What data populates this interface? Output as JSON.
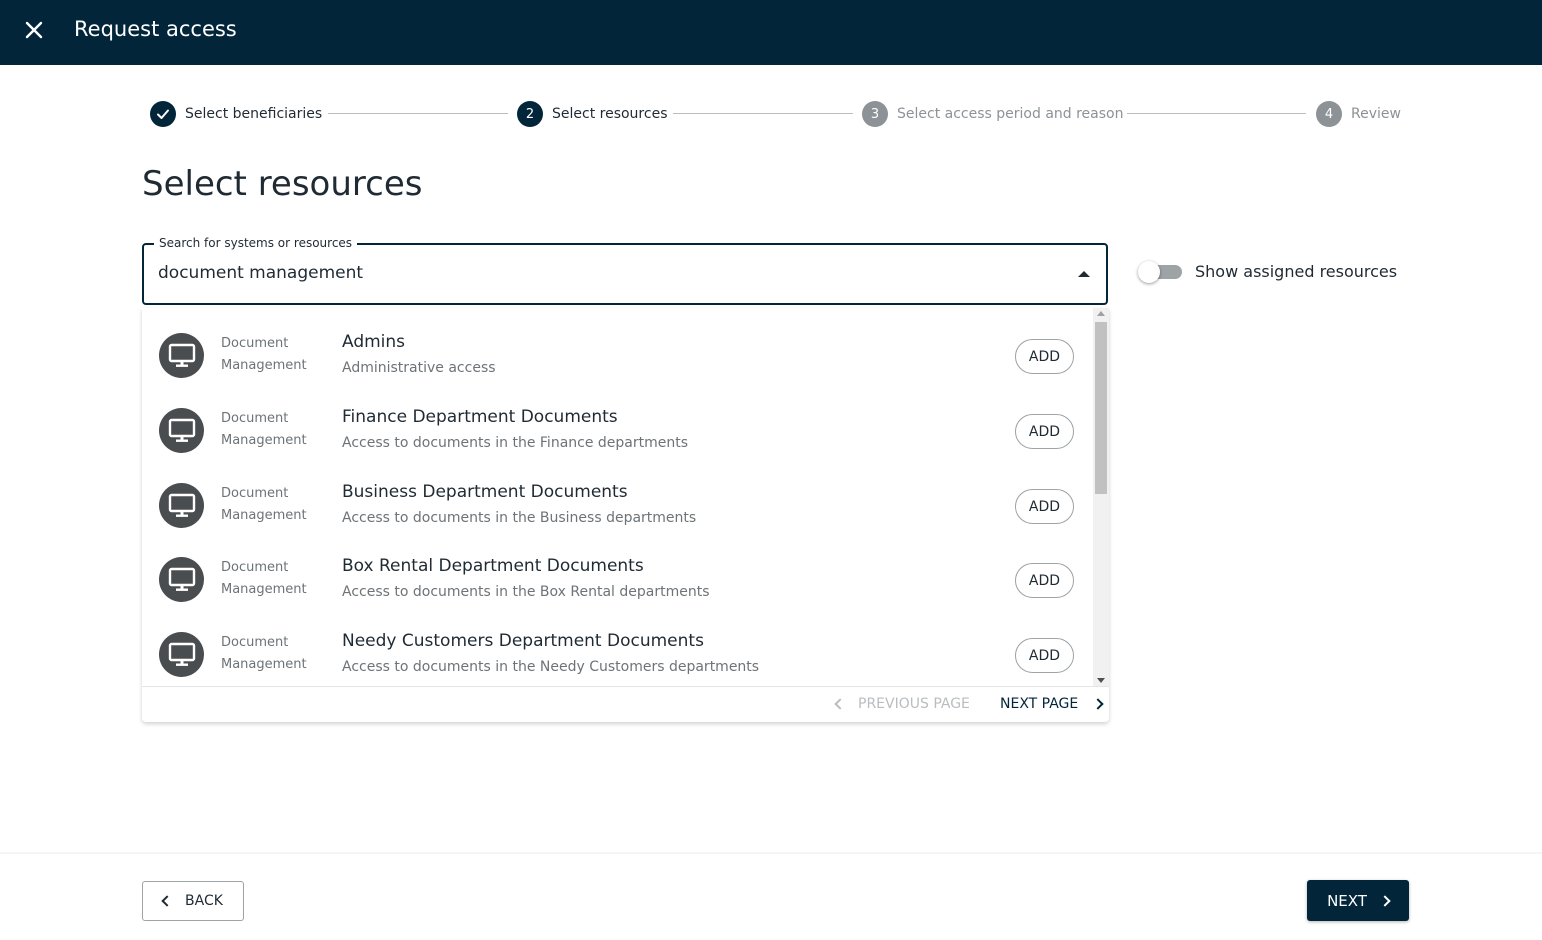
{
  "header": {
    "title": "Request access",
    "close_icon": "close-icon"
  },
  "stepper": {
    "steps": [
      {
        "number": "",
        "label": "Select beneficiaries",
        "state": "done"
      },
      {
        "number": "2",
        "label": "Select resources",
        "state": "active"
      },
      {
        "number": "3",
        "label": "Select access period and reason",
        "state": "pending"
      },
      {
        "number": "4",
        "label": "Review",
        "state": "pending"
      }
    ]
  },
  "main": {
    "title": "Select resources",
    "search": {
      "label": "Search for systems or resources",
      "value": "document management"
    },
    "toggle": {
      "label": "Show assigned resources",
      "on": false
    }
  },
  "results": {
    "items": [
      {
        "system_line1": "Document",
        "system_line2": "Management",
        "name": "Admins",
        "description": "Administrative access",
        "action": "ADD",
        "icon": "monitor-icon"
      },
      {
        "system_line1": "Document",
        "system_line2": "Management",
        "name": "Finance Department Documents",
        "description": "Access to documents in the Finance departments",
        "action": "ADD",
        "icon": "monitor-icon"
      },
      {
        "system_line1": "Document",
        "system_line2": "Management",
        "name": "Business Department Documents",
        "description": "Access to documents in the Business departments",
        "action": "ADD",
        "icon": "monitor-icon"
      },
      {
        "system_line1": "Document",
        "system_line2": "Management",
        "name": "Box Rental Department Documents",
        "description": "Access to documents in the Box Rental departments",
        "action": "ADD",
        "icon": "monitor-icon"
      },
      {
        "system_line1": "Document",
        "system_line2": "Management",
        "name": "Needy Customers Department Documents",
        "description": "Access to documents in the Needy Customers departments",
        "action": "ADD",
        "icon": "monitor-icon"
      }
    ],
    "pager": {
      "previous": "PREVIOUS PAGE",
      "next": "NEXT PAGE"
    }
  },
  "footer": {
    "back": "BACK",
    "next": "NEXT"
  },
  "colors": {
    "primary": "#02253a",
    "muted": "#8c9296",
    "icon_bg": "#4a4d50"
  }
}
